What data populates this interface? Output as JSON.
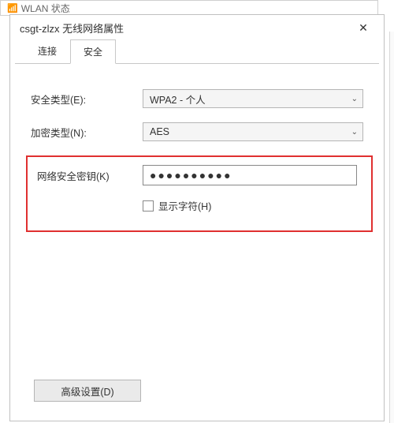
{
  "bg_window": {
    "title": "WLAN 状态"
  },
  "titlebar": {
    "title": "csgt-zlzx 无线网络属性"
  },
  "tabs": {
    "connection": "连接",
    "security": "安全"
  },
  "fields": {
    "security_type": {
      "label": "安全类型(E):",
      "value": "WPA2 - 个人"
    },
    "encryption_type": {
      "label": "加密类型(N):",
      "value": "AES"
    },
    "network_key": {
      "label": "网络安全密钥(K)",
      "value": "●●●●●●●●●●"
    },
    "show_chars": {
      "label": "显示字符(H)"
    }
  },
  "buttons": {
    "advanced": "高级设置(D)"
  }
}
